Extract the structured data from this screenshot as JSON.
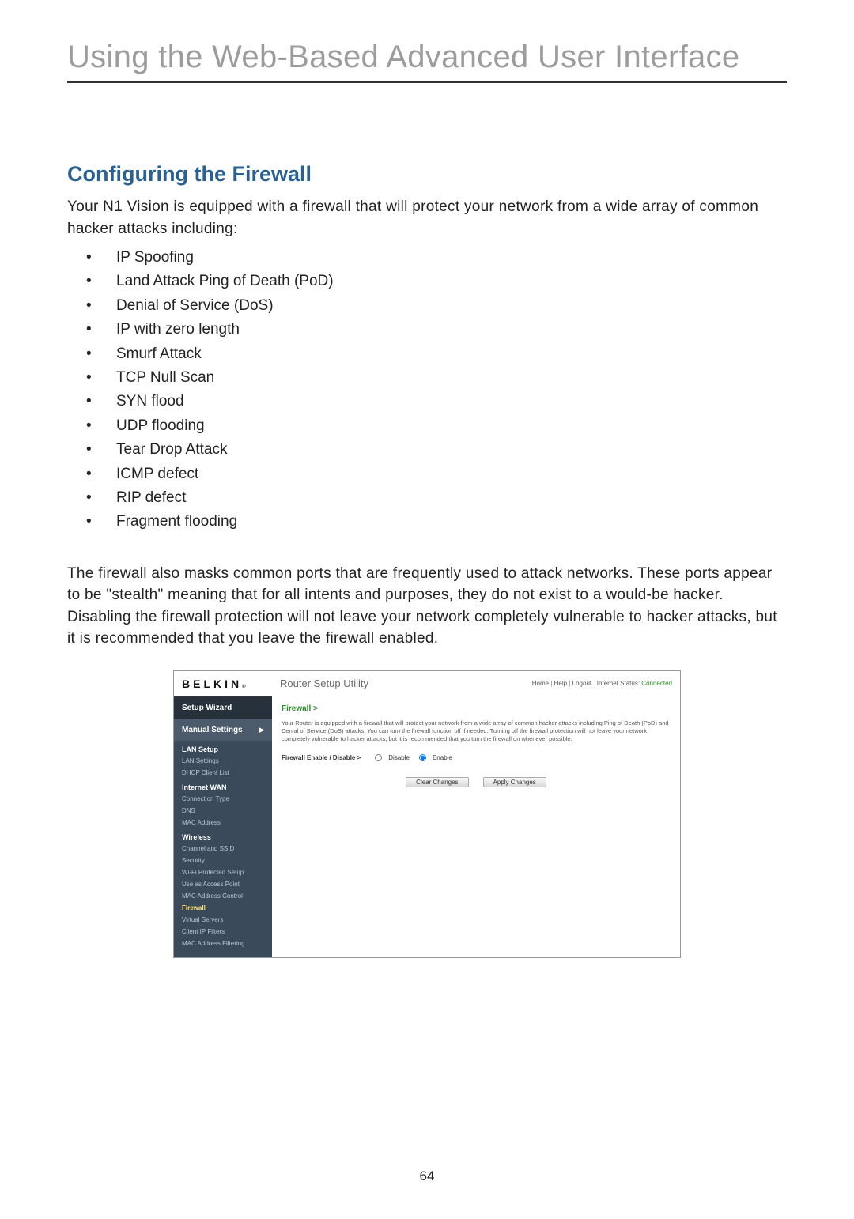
{
  "doc": {
    "page_title": "Using the Web-Based Advanced User Interface",
    "section_title": "Configuring the Firewall",
    "intro": "Your N1 Vision is equipped with a firewall that will protect your network from a wide array of common hacker attacks including:",
    "attacks": [
      "IP Spoofing",
      "Land Attack Ping of Death (PoD)",
      "Denial of Service (DoS)",
      "IP with zero length",
      "Smurf Attack",
      "TCP Null Scan",
      "SYN flood",
      "UDP flooding",
      "Tear Drop Attack",
      "ICMP defect",
      "RIP defect",
      "Fragment flooding"
    ],
    "para2": "The firewall also masks common ports that are frequently used to attack networks. These ports appear to be \"stealth\" meaning that for all intents and purposes, they do not exist to a would-be hacker. Disabling the firewall protection will not leave your network completely vulnerable to hacker attacks, but it is recommended that you leave the firewall enabled.",
    "page_number": "64"
  },
  "ui": {
    "brand": "BELKIN",
    "brand_suffix": "®",
    "utility_title": "Router Setup Utility",
    "top_links": {
      "home": "Home",
      "help": "Help",
      "logout": "Logout",
      "status_label": "Internet Status:",
      "status_value": "Connected"
    },
    "sidebar": {
      "setup_wizard": "Setup Wizard",
      "manual_settings": "Manual Settings",
      "sections": {
        "lan_setup": "LAN Setup",
        "lan_settings": "LAN Settings",
        "dhcp_client_list": "DHCP Client List",
        "internet_wan": "Internet WAN",
        "connection_type": "Connection Type",
        "dns": "DNS",
        "mac_address": "MAC Address",
        "wireless": "Wireless",
        "channel_ssid": "Channel and SSID",
        "security": "Security",
        "wps": "Wi-Fi Protected Setup",
        "use_as_ap": "Use as Access Point",
        "mac_addr_ctrl": "MAC Address Control",
        "firewall": "Firewall",
        "virtual_servers": "Virtual Servers",
        "client_ip_filters": "Client IP Filters",
        "mac_filtering": "MAC Address Filtering"
      }
    },
    "content": {
      "breadcrumb": "Firewall >",
      "desc": "Your Router is equipped with a firewall that will protect your network from a wide array of common hacker attacks including Ping of Death (PoD) and Denial of Service (DoS) attacks. You can turn the firewall function off if needed. Turning off the firewall protection will not leave your network completely vulnerable to hacker attacks, but it is recommended that you turn the firewall on whenever possible.",
      "fw_label": "Firewall Enable / Disable >",
      "opt_disable": "Disable",
      "opt_enable": "Enable",
      "btn_clear": "Clear Changes",
      "btn_apply": "Apply Changes"
    }
  }
}
